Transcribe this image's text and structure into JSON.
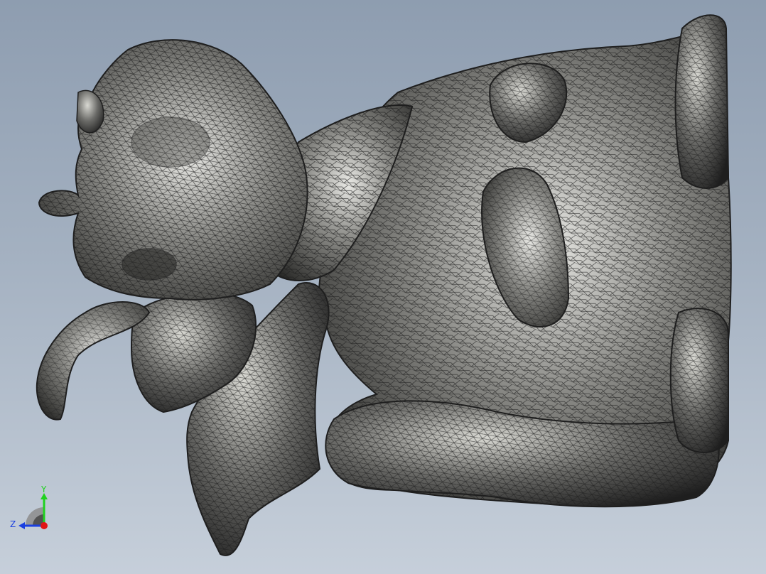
{
  "viewport": {
    "background_top": "#8e9db0",
    "background_bottom": "#c6cfda"
  },
  "model": {
    "description_icon": "dragon-mesh-model",
    "render_style": "shaded-with-edges",
    "surface_color": "#6b6b68",
    "edge_color": "#1e1e1e",
    "highlight_color": "#e8e8e4"
  },
  "triad": {
    "y_label": "Y",
    "z_label": "Z",
    "y_color": "#1fd21f",
    "z_color": "#1a3fe0",
    "x_color": "#e01515"
  }
}
